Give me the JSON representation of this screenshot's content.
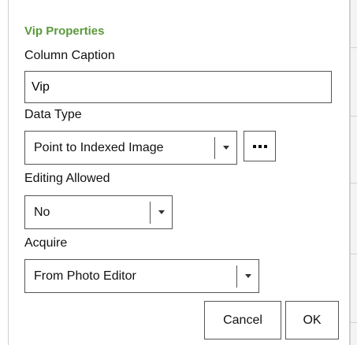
{
  "dialog": {
    "title": "Vip Properties",
    "column_caption": {
      "label": "Column Caption",
      "value": "Vip"
    },
    "data_type": {
      "label": "Data Type",
      "selected": "Point to Indexed Image",
      "more_button_icon": "ellipsis-icon"
    },
    "editing_allowed": {
      "label": "Editing Allowed",
      "selected": "No"
    },
    "acquire": {
      "label": "Acquire",
      "selected": "From Photo Editor"
    },
    "buttons": {
      "cancel": "Cancel",
      "ok": "OK"
    }
  },
  "colors": {
    "title": "#5a9a3a",
    "border": "#555555",
    "text": "#111111"
  }
}
